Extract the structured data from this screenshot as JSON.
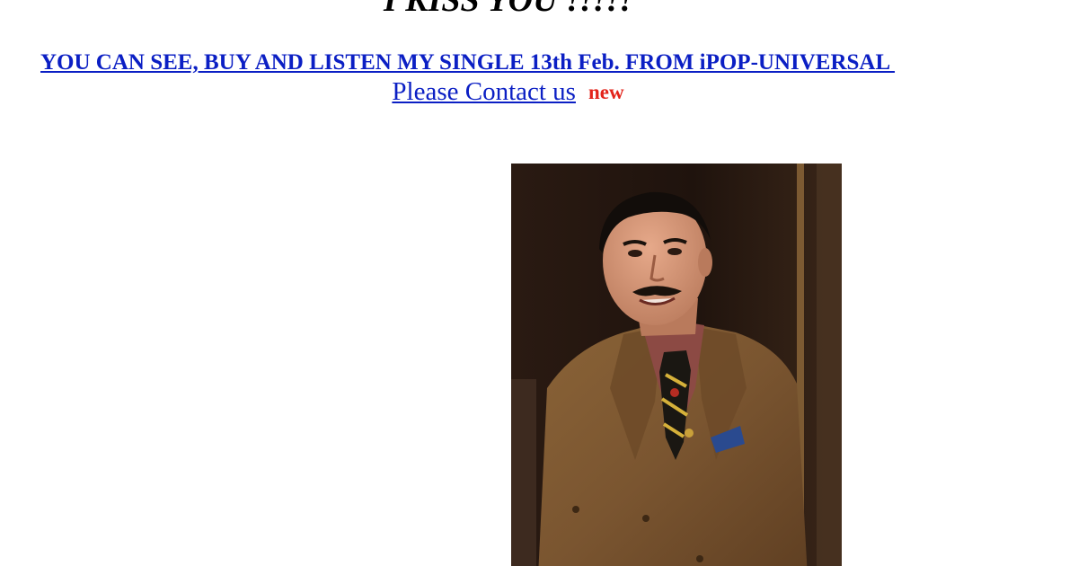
{
  "header": {
    "headline": "I KISS YOU !!!!!"
  },
  "links": {
    "single_announcement": "YOU CAN SEE, BUY AND LISTEN MY SINGLE 13th Feb. FROM iPOP-UNIVERSAL ",
    "contact": "Please Contact us",
    "new_badge": "new"
  },
  "colors": {
    "link": "#0b1fc4",
    "new_badge": "#e3241b",
    "background": "#ffffff"
  }
}
